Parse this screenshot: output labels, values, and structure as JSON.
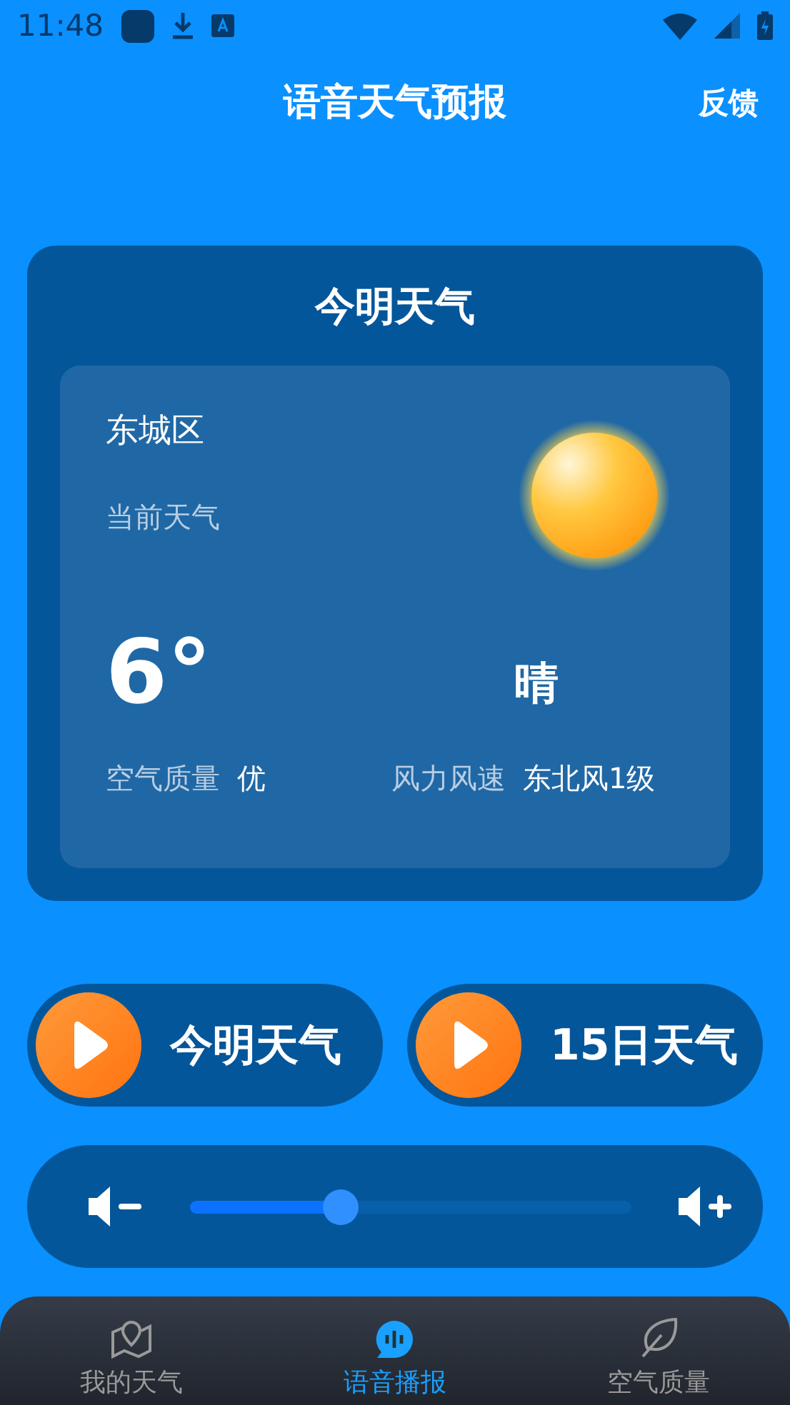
{
  "status_bar": {
    "time": "11:48"
  },
  "header": {
    "title": "语音天气预报",
    "action": "反馈"
  },
  "card": {
    "title": "今明天气",
    "district": "东城区",
    "subtitle": "当前天气",
    "temperature": "6°",
    "condition": "晴",
    "air_label": "空气质量",
    "air_value": "优",
    "wind_label": "风力风速",
    "wind_value": "东北风1级"
  },
  "play_buttons": [
    {
      "label": "今明天气"
    },
    {
      "label": "15日天气"
    }
  ],
  "volume": {
    "level": 0.34
  },
  "nav": [
    {
      "label": "我的天气",
      "kind": "map",
      "selected": false
    },
    {
      "label": "语音播报",
      "kind": "voice",
      "selected": true
    },
    {
      "label": "空气质量",
      "kind": "leaf",
      "selected": false
    }
  ]
}
